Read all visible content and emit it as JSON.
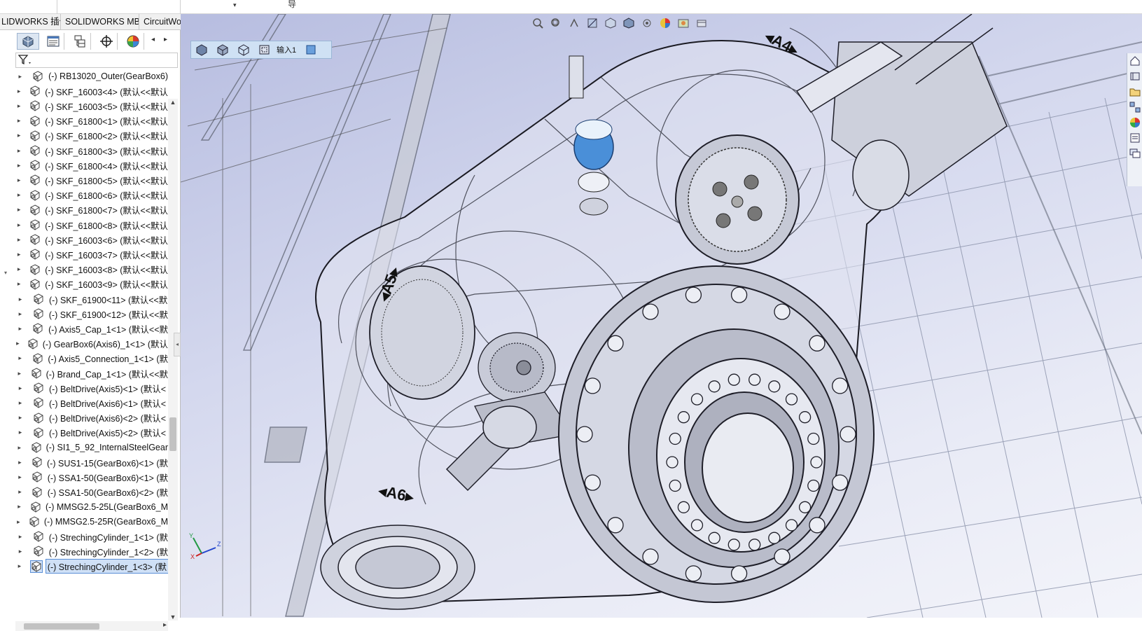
{
  "topbar": {
    "search_dropdown_arrow": "▾",
    "guide_char": "导"
  },
  "ribbon_tabs": [
    {
      "label": "LIDWORKS 插件"
    },
    {
      "label": "SOLIDWORKS MBD"
    },
    {
      "label": "CircuitWorks"
    }
  ],
  "panel_tabs": [
    {
      "icon": "feature-manager-icon"
    },
    {
      "icon": "property-manager-icon"
    },
    {
      "icon": "configuration-manager-icon"
    },
    {
      "icon": "dimxpert-manager-icon"
    },
    {
      "icon": "display-manager-icon"
    }
  ],
  "panel_nav": {
    "left": "◂",
    "right": "▸"
  },
  "filter": {
    "icon": "filter-icon"
  },
  "tree_items": [
    {
      "label": "(-) RB13020_Outer(GearBox6)"
    },
    {
      "label": "(-) SKF_16003<4> (默认<<默认"
    },
    {
      "label": "(-) SKF_16003<5> (默认<<默认"
    },
    {
      "label": "(-) SKF_61800<1> (默认<<默认"
    },
    {
      "label": "(-) SKF_61800<2> (默认<<默认"
    },
    {
      "label": "(-) SKF_61800<3> (默认<<默认"
    },
    {
      "label": "(-) SKF_61800<4> (默认<<默认"
    },
    {
      "label": "(-) SKF_61800<5> (默认<<默认"
    },
    {
      "label": "(-) SKF_61800<6> (默认<<默认"
    },
    {
      "label": "(-) SKF_61800<7> (默认<<默认"
    },
    {
      "label": "(-) SKF_61800<8> (默认<<默认"
    },
    {
      "label": "(-) SKF_16003<6> (默认<<默认"
    },
    {
      "label": "(-) SKF_16003<7> (默认<<默认"
    },
    {
      "label": "(-) SKF_16003<8> (默认<<默认"
    },
    {
      "label": "(-) SKF_16003<9> (默认<<默认"
    },
    {
      "label": "(-) SKF_61900<11> (默认<<默"
    },
    {
      "label": "(-) SKF_61900<12> (默认<<默"
    },
    {
      "label": "(-) Axis5_Cap_1<1> (默认<<默"
    },
    {
      "label": "(-) GearBox6(Axis6)_1<1> (默认"
    },
    {
      "label": "(-) Axis5_Connection_1<1> (默"
    },
    {
      "label": "(-) Brand_Cap_1<1> (默认<<默"
    },
    {
      "label": "(-) BeltDrive(Axis5)<1> (默认<"
    },
    {
      "label": "(-) BeltDrive(Axis6)<1> (默认<"
    },
    {
      "label": "(-) BeltDrive(Axis6)<2> (默认<"
    },
    {
      "label": "(-) BeltDrive(Axis5)<2> (默认<"
    },
    {
      "label": "(-) SI1_5_92_InternalSteelGear"
    },
    {
      "label": "(-) SUS1-15(GearBox6)<1> (默"
    },
    {
      "label": "(-) SSA1-50(GearBox6)<1> (默"
    },
    {
      "label": "(-) SSA1-50(GearBox6)<2> (默"
    },
    {
      "label": "(-) MMSG2.5-25L(GearBox6_M"
    },
    {
      "label": "(-) MMSG2.5-25R(GearBox6_M"
    },
    {
      "label": "(-) StrechingCylinder_1<1> (默"
    },
    {
      "label": "(-) StrechingCylinder_1<2> (默"
    },
    {
      "label": "(-) StrechingCylinder_1<3> (默"
    }
  ],
  "selected_index": 33,
  "scroll": {
    "up": "▲",
    "down": "▼",
    "right": "▸"
  },
  "view_toolbar": {
    "label": "输入1"
  },
  "model_labels": {
    "a4": "◂A4▸",
    "a5": "◂A5▸",
    "a6": "◂A6▸"
  },
  "triad": {
    "x": "X",
    "y": "Y",
    "z": "Z"
  },
  "colors": {
    "selection": "#cfe0f6",
    "accent": "#5b8fd6",
    "viewport_top": "#b7bde0"
  }
}
